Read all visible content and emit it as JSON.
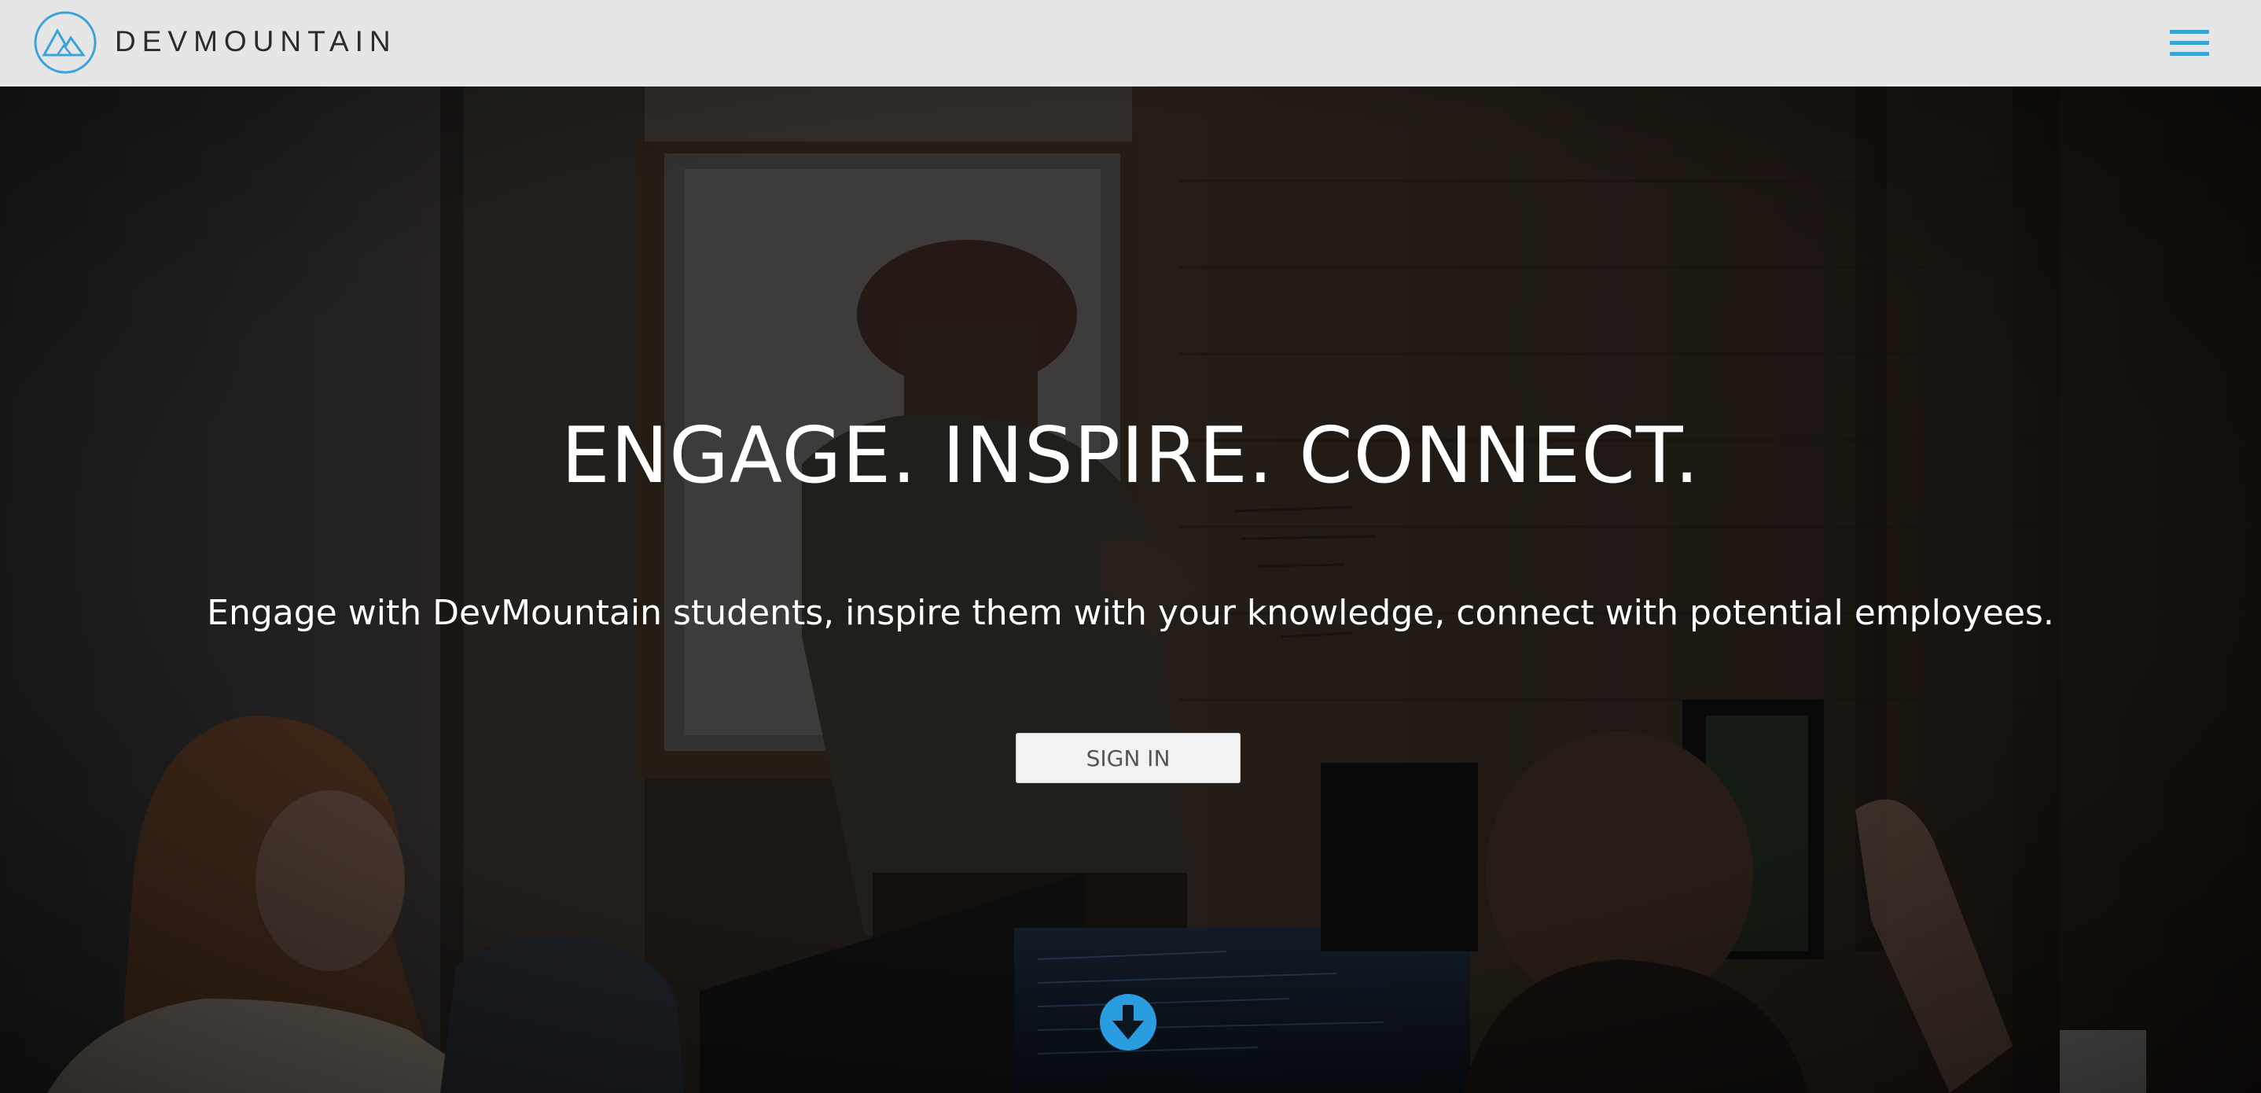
{
  "navbar": {
    "brand_name": "DEVMOUNTAIN",
    "logo_icon": "mountain-logo-icon",
    "menu_icon": "hamburger-menu-icon"
  },
  "hero": {
    "title": "ENGAGE. INSPIRE. CONNECT.",
    "subtitle": "Engage with DevMountain students, inspire them with your knowledge, connect with potential employees.",
    "sign_in_label": "SIGN IN",
    "scroll_icon": "arrow-down-circle-icon"
  },
  "colors": {
    "accent": "#3aa3db",
    "navbar_bg": "#e6e6e6",
    "brand_text": "#2b2b2b",
    "button_bg": "#f2f2f2",
    "button_text": "#555555",
    "hero_text": "#ffffff"
  }
}
